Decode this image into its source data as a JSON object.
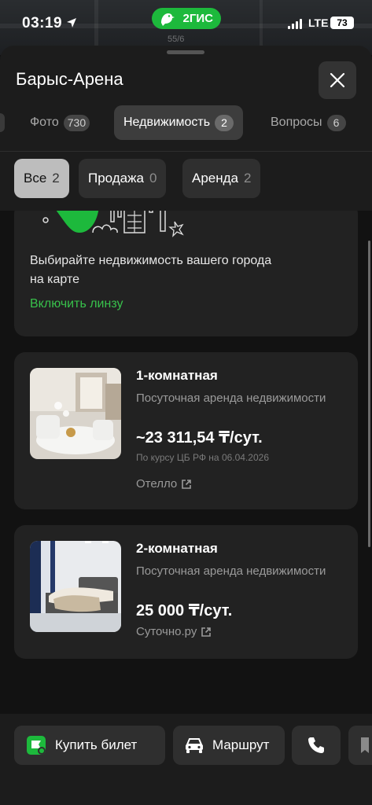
{
  "status_bar": {
    "time": "03:19",
    "brand": "2ГИС",
    "map_label": "55/6",
    "network": "LTE",
    "battery": "73"
  },
  "place": {
    "title": "Барыс-Арена"
  },
  "tabs": [
    {
      "label": "Фото",
      "count": "730"
    },
    {
      "label": "Недвижимость",
      "count": "2",
      "active": true
    },
    {
      "label": "Вопросы",
      "count": "6"
    }
  ],
  "filters": [
    {
      "label": "Все",
      "count": "2",
      "active": true
    },
    {
      "label": "Продажа",
      "count": "0"
    },
    {
      "label": "Аренда",
      "count": "2"
    }
  ],
  "promo": {
    "text": "Выбирайте недвижимость вашего города на карте",
    "link": "Включить линзу"
  },
  "listings": [
    {
      "name": "1-комнатная",
      "description": "Посуточная аренда недвижимости",
      "price": "~23 311,54 ₸/сут.",
      "note": "По курсу ЦБ РФ на 06.04.2026",
      "source": "Отелло"
    },
    {
      "name": "2-комнатная",
      "description": "Посуточная аренда недвижимости",
      "price": "25 000 ₸/сут.",
      "source": "Суточно.ру"
    }
  ],
  "bottom_actions": {
    "buy_ticket": "Купить билет",
    "route": "Маршрут"
  },
  "colors": {
    "accent_green": "#38c14b",
    "brand_green": "#1db93c",
    "sheet_bg": "#1c1c1c",
    "card_bg": "#222222"
  }
}
